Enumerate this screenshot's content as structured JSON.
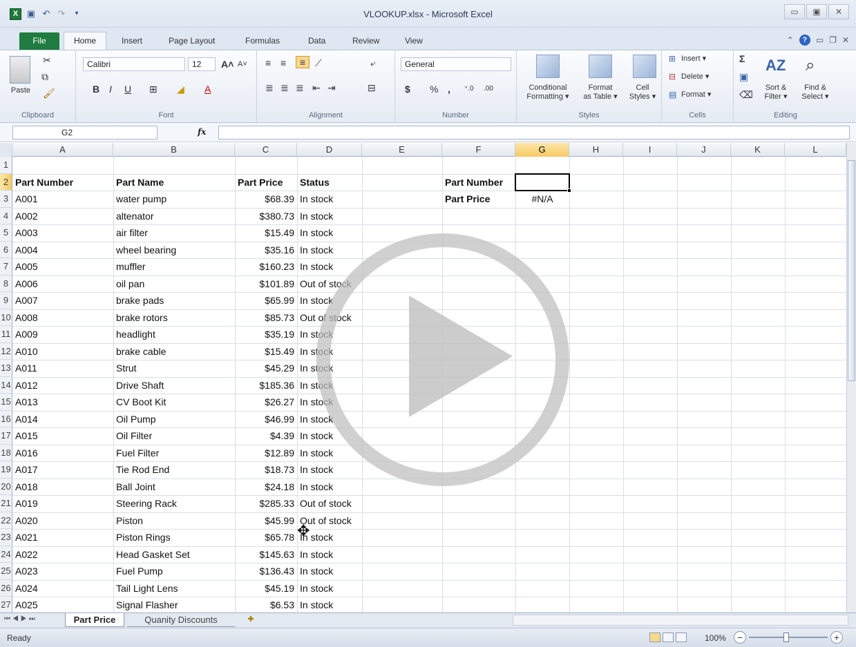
{
  "window": {
    "title": "VLOOKUP.xlsx - Microsoft Excel"
  },
  "tabs": [
    "File",
    "Home",
    "Insert",
    "Page Layout",
    "Formulas",
    "Data",
    "Review",
    "View"
  ],
  "ribbon": {
    "clipboard": {
      "paste": "Paste",
      "label": "Clipboard"
    },
    "font": {
      "name": "Calibri",
      "size": "12",
      "label": "Font"
    },
    "alignment": {
      "label": "Alignment"
    },
    "number": {
      "format": "General",
      "currency": "$",
      "percent": "%",
      "comma": ",",
      "label": "Number"
    },
    "styles": {
      "conditional": "Conditional\nFormatting",
      "conditional1": "Conditional",
      "conditional2": "Formatting ▾",
      "format_table1": "Format",
      "format_table2": "as Table ▾",
      "cell_styles1": "Cell",
      "cell_styles2": "Styles ▾",
      "label": "Styles"
    },
    "cells": {
      "insert": "Insert ▾",
      "delete": "Delete ▾",
      "format": "Format ▾",
      "label": "Cells"
    },
    "editing": {
      "sort1": "Sort &",
      "sort2": "Filter ▾",
      "find1": "Find &",
      "find2": "Select ▾",
      "label": "Editing"
    }
  },
  "formula_bar": {
    "name_box": "G2",
    "fx": "fx",
    "formula": ""
  },
  "columns": [
    "A",
    "B",
    "C",
    "D",
    "E",
    "F",
    "G",
    "H",
    "I",
    "J",
    "K",
    "L"
  ],
  "header_row": {
    "part_number": "Part Number",
    "part_name": "Part Name",
    "part_price": "Part Price",
    "status": "Status"
  },
  "lookup": {
    "label1": "Part Number",
    "label2": "Part Price",
    "result": "#N/A"
  },
  "rows": [
    {
      "r": "3",
      "a": "A001",
      "b": "water pump",
      "c": "$68.39",
      "d": "In stock"
    },
    {
      "r": "4",
      "a": "A002",
      "b": "altenator",
      "c": "$380.73",
      "d": "In stock"
    },
    {
      "r": "5",
      "a": "A003",
      "b": "air filter",
      "c": "$15.49",
      "d": "In stock"
    },
    {
      "r": "6",
      "a": "A004",
      "b": "wheel bearing",
      "c": "$35.16",
      "d": "In stock"
    },
    {
      "r": "7",
      "a": "A005",
      "b": "muffler",
      "c": "$160.23",
      "d": "In stock"
    },
    {
      "r": "8",
      "a": "A006",
      "b": "oil pan",
      "c": "$101.89",
      "d": "Out of stock"
    },
    {
      "r": "9",
      "a": "A007",
      "b": "brake pads",
      "c": "$65.99",
      "d": "In stock"
    },
    {
      "r": "10",
      "a": "A008",
      "b": "brake rotors",
      "c": "$85.73",
      "d": "Out of stock"
    },
    {
      "r": "11",
      "a": "A009",
      "b": "headlight",
      "c": "$35.19",
      "d": "In stock"
    },
    {
      "r": "12",
      "a": "A010",
      "b": "brake cable",
      "c": "$15.49",
      "d": "In stock"
    },
    {
      "r": "13",
      "a": "A011",
      "b": "Strut",
      "c": "$45.29",
      "d": "In stock"
    },
    {
      "r": "14",
      "a": "A012",
      "b": "Drive Shaft",
      "c": "$185.36",
      "d": "In stock"
    },
    {
      "r": "15",
      "a": "A013",
      "b": "CV Boot Kit",
      "c": "$26.27",
      "d": "In stock"
    },
    {
      "r": "16",
      "a": "A014",
      "b": "Oil Pump",
      "c": "$46.99",
      "d": "In stock"
    },
    {
      "r": "17",
      "a": "A015",
      "b": "Oil Filter",
      "c": "$4.39",
      "d": "In stock"
    },
    {
      "r": "18",
      "a": "A016",
      "b": "Fuel Filter",
      "c": "$12.89",
      "d": "In stock"
    },
    {
      "r": "19",
      "a": "A017",
      "b": "Tie Rod End",
      "c": "$18.73",
      "d": "In stock"
    },
    {
      "r": "20",
      "a": "A018",
      "b": "Ball Joint",
      "c": "$24.18",
      "d": "In stock"
    },
    {
      "r": "21",
      "a": "A019",
      "b": "Steering Rack",
      "c": "$285.33",
      "d": "Out of stock"
    },
    {
      "r": "22",
      "a": "A020",
      "b": "Piston",
      "c": "$45.99",
      "d": "Out of stock"
    },
    {
      "r": "23",
      "a": "A021",
      "b": "Piston Rings",
      "c": "$65.78",
      "d": "In stock"
    },
    {
      "r": "24",
      "a": "A022",
      "b": "Head Gasket Set",
      "c": "$145.63",
      "d": "In stock"
    },
    {
      "r": "25",
      "a": "A023",
      "b": "Fuel Pump",
      "c": "$136.43",
      "d": "In stock"
    },
    {
      "r": "26",
      "a": "A024",
      "b": "Tail Light Lens",
      "c": "$45.19",
      "d": "In stock"
    },
    {
      "r": "27",
      "a": "A025",
      "b": "Signal Flasher",
      "c": "$6.53",
      "d": "In stock"
    }
  ],
  "sheet_tabs": {
    "active": "Part Price",
    "other": "Quanity Discounts"
  },
  "status": {
    "ready": "Ready",
    "zoom": "100%"
  },
  "colors": {
    "accent": "#1f7b3f",
    "selected_header": "#f6c964"
  }
}
